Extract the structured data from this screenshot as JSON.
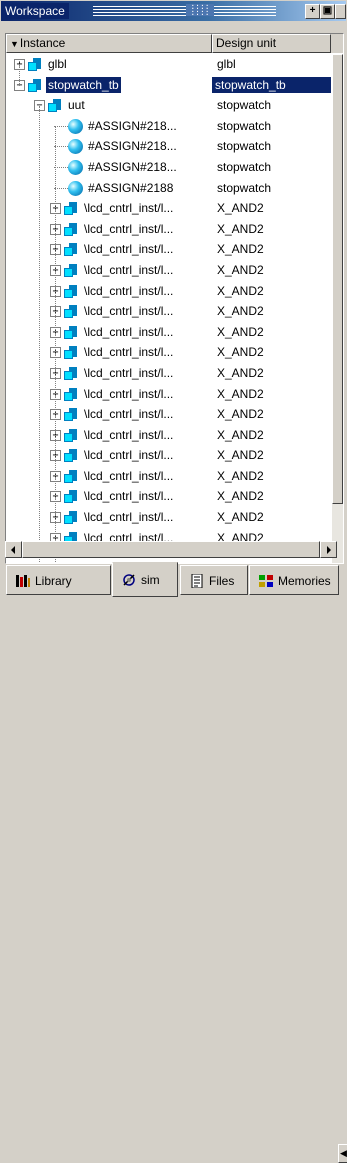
{
  "title": "Workspace",
  "columns": {
    "instance": "Instance",
    "design_unit": "Design unit"
  },
  "rows": [
    {
      "name": "glbl",
      "unit": "glbl",
      "depth": 0,
      "expander": "+",
      "icon": "instance-icon"
    },
    {
      "name": "stopwatch_tb",
      "unit": "stopwatch_tb",
      "depth": 0,
      "expander": "-",
      "icon": "instance-icon",
      "selected": true
    },
    {
      "name": "uut",
      "unit": "stopwatch",
      "depth": 1,
      "expander": "-",
      "icon": "instance-icon"
    },
    {
      "name": "#ASSIGN#218...",
      "unit": "stopwatch",
      "depth": 2,
      "expander": "",
      "icon": "process-icon"
    },
    {
      "name": "#ASSIGN#218...",
      "unit": "stopwatch",
      "depth": 2,
      "expander": "",
      "icon": "process-icon"
    },
    {
      "name": "#ASSIGN#218...",
      "unit": "stopwatch",
      "depth": 2,
      "expander": "",
      "icon": "process-icon"
    },
    {
      "name": "#ASSIGN#2188",
      "unit": "stopwatch",
      "depth": 2,
      "expander": "",
      "icon": "process-icon"
    },
    {
      "name": "\\lcd_cntrl_inst/l...",
      "unit": "X_AND2",
      "depth": 2,
      "expander": "+",
      "icon": "instance-icon"
    },
    {
      "name": "\\lcd_cntrl_inst/l...",
      "unit": "X_AND2",
      "depth": 2,
      "expander": "+",
      "icon": "instance-icon"
    },
    {
      "name": "\\lcd_cntrl_inst/l...",
      "unit": "X_AND2",
      "depth": 2,
      "expander": "+",
      "icon": "instance-icon"
    },
    {
      "name": "\\lcd_cntrl_inst/l...",
      "unit": "X_AND2",
      "depth": 2,
      "expander": "+",
      "icon": "instance-icon"
    },
    {
      "name": "\\lcd_cntrl_inst/l...",
      "unit": "X_AND2",
      "depth": 2,
      "expander": "+",
      "icon": "instance-icon"
    },
    {
      "name": "\\lcd_cntrl_inst/l...",
      "unit": "X_AND2",
      "depth": 2,
      "expander": "+",
      "icon": "instance-icon"
    },
    {
      "name": "\\lcd_cntrl_inst/l...",
      "unit": "X_AND2",
      "depth": 2,
      "expander": "+",
      "icon": "instance-icon"
    },
    {
      "name": "\\lcd_cntrl_inst/l...",
      "unit": "X_AND2",
      "depth": 2,
      "expander": "+",
      "icon": "instance-icon"
    },
    {
      "name": "\\lcd_cntrl_inst/l...",
      "unit": "X_AND2",
      "depth": 2,
      "expander": "+",
      "icon": "instance-icon"
    },
    {
      "name": "\\lcd_cntrl_inst/l...",
      "unit": "X_AND2",
      "depth": 2,
      "expander": "+",
      "icon": "instance-icon"
    },
    {
      "name": "\\lcd_cntrl_inst/l...",
      "unit": "X_AND2",
      "depth": 2,
      "expander": "+",
      "icon": "instance-icon"
    },
    {
      "name": "\\lcd_cntrl_inst/l...",
      "unit": "X_AND2",
      "depth": 2,
      "expander": "+",
      "icon": "instance-icon"
    },
    {
      "name": "\\lcd_cntrl_inst/l...",
      "unit": "X_AND2",
      "depth": 2,
      "expander": "+",
      "icon": "instance-icon"
    },
    {
      "name": "\\lcd_cntrl_inst/l...",
      "unit": "X_AND2",
      "depth": 2,
      "expander": "+",
      "icon": "instance-icon"
    },
    {
      "name": "\\lcd_cntrl_inst/l...",
      "unit": "X_AND2",
      "depth": 2,
      "expander": "+",
      "icon": "instance-icon"
    },
    {
      "name": "\\lcd_cntrl_inst/l...",
      "unit": "X_AND2",
      "depth": 2,
      "expander": "+",
      "icon": "instance-icon"
    },
    {
      "name": "\\lcd_cntrl_inst/l...",
      "unit": "X_AND2",
      "depth": 2,
      "expander": "+",
      "icon": "instance-icon"
    }
  ],
  "tabs": [
    {
      "label": "Library",
      "icon": "library-icon",
      "active": false
    },
    {
      "label": "sim",
      "icon": "sim-icon",
      "active": true
    },
    {
      "label": "Files",
      "icon": "files-icon",
      "active": false
    },
    {
      "label": "Memories",
      "icon": "memories-icon",
      "active": false
    }
  ],
  "colors": {
    "selection": "#0a246a",
    "title_bar": "#0a246a",
    "instance_icon": "#00e0ff",
    "process_icon": "#30c0f0"
  }
}
